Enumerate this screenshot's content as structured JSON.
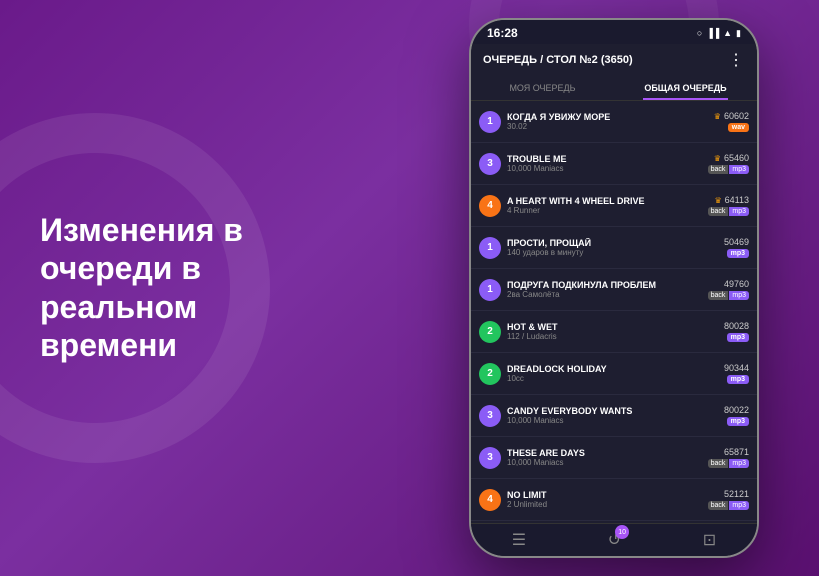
{
  "background": {
    "gradient_start": "#6a1a8a",
    "gradient_end": "#5a1070"
  },
  "hero": {
    "text": "Изменения в очереди в реальном времени"
  },
  "phone": {
    "status_bar": {
      "time": "16:28",
      "circle_icon": "○",
      "signal": "▐▐▐",
      "wifi": "wifi",
      "battery": "🔋"
    },
    "header": {
      "title": "ОЧЕРЕДЬ / СТОЛ №2 (3650)",
      "menu_label": "⋮"
    },
    "tabs": [
      {
        "label": "МОЯ ОЧЕРЕДЬ",
        "active": false
      },
      {
        "label": "ОБЩАЯ ОЧЕРЕДЬ",
        "active": true
      }
    ],
    "songs": [
      {
        "number": "1",
        "num_color": "purple",
        "title": "КОГДА Я УВИЖУ МОРЕ",
        "artist": "30.02",
        "id": "60602",
        "has_crown": true,
        "badge_type": "wav"
      },
      {
        "number": "3",
        "num_color": "purple",
        "title": "TROUBLE ME",
        "artist": "10,000 Maniacs",
        "id": "65460",
        "has_crown": true,
        "badge_type": "back-mp3"
      },
      {
        "number": "4",
        "num_color": "orange",
        "title": "A HEART WITH 4 WHEEL DRIVE",
        "artist": "4 Runner",
        "id": "64113",
        "has_crown": true,
        "badge_type": "back-mp3"
      },
      {
        "number": "1",
        "num_color": "purple",
        "title": "ПРОСТИ, ПРОЩАЙ",
        "artist": "140 ударов в минуту",
        "id": "50469",
        "has_crown": false,
        "badge_type": "mp3"
      },
      {
        "number": "1",
        "num_color": "purple",
        "title": "ПОДРУГА ПОДКИНУЛА ПРОБЛЕМ",
        "artist": "2ва Самолёта",
        "id": "49760",
        "has_crown": false,
        "badge_type": "back-mp3"
      },
      {
        "number": "2",
        "num_color": "green",
        "title": "HOT & WET",
        "artist": "112 / Ludacris",
        "id": "80028",
        "has_crown": false,
        "badge_type": "mp3"
      },
      {
        "number": "2",
        "num_color": "green",
        "title": "DREADLOCK HOLIDAY",
        "artist": "10cc",
        "id": "90344",
        "has_crown": false,
        "badge_type": "mp3"
      },
      {
        "number": "3",
        "num_color": "purple",
        "title": "CANDY EVERYBODY WANTS",
        "artist": "10,000 Maniacs",
        "id": "80022",
        "has_crown": false,
        "badge_type": "mp3"
      },
      {
        "number": "3",
        "num_color": "purple",
        "title": "THESE ARE DAYS",
        "artist": "10,000 Maniacs",
        "id": "65871",
        "has_crown": false,
        "badge_type": "back-mp3"
      },
      {
        "number": "4",
        "num_color": "orange",
        "title": "NO LIMIT",
        "artist": "2 Unlimited",
        "id": "52121",
        "has_crown": false,
        "badge_type": "back-mp3"
      }
    ],
    "bottom_nav": [
      {
        "icon": "☰",
        "label": "queue-icon",
        "badge": null
      },
      {
        "icon": "↺",
        "label": "history-icon",
        "badge": "10"
      },
      {
        "icon": "⊡",
        "label": "screen-icon",
        "badge": null
      }
    ]
  }
}
